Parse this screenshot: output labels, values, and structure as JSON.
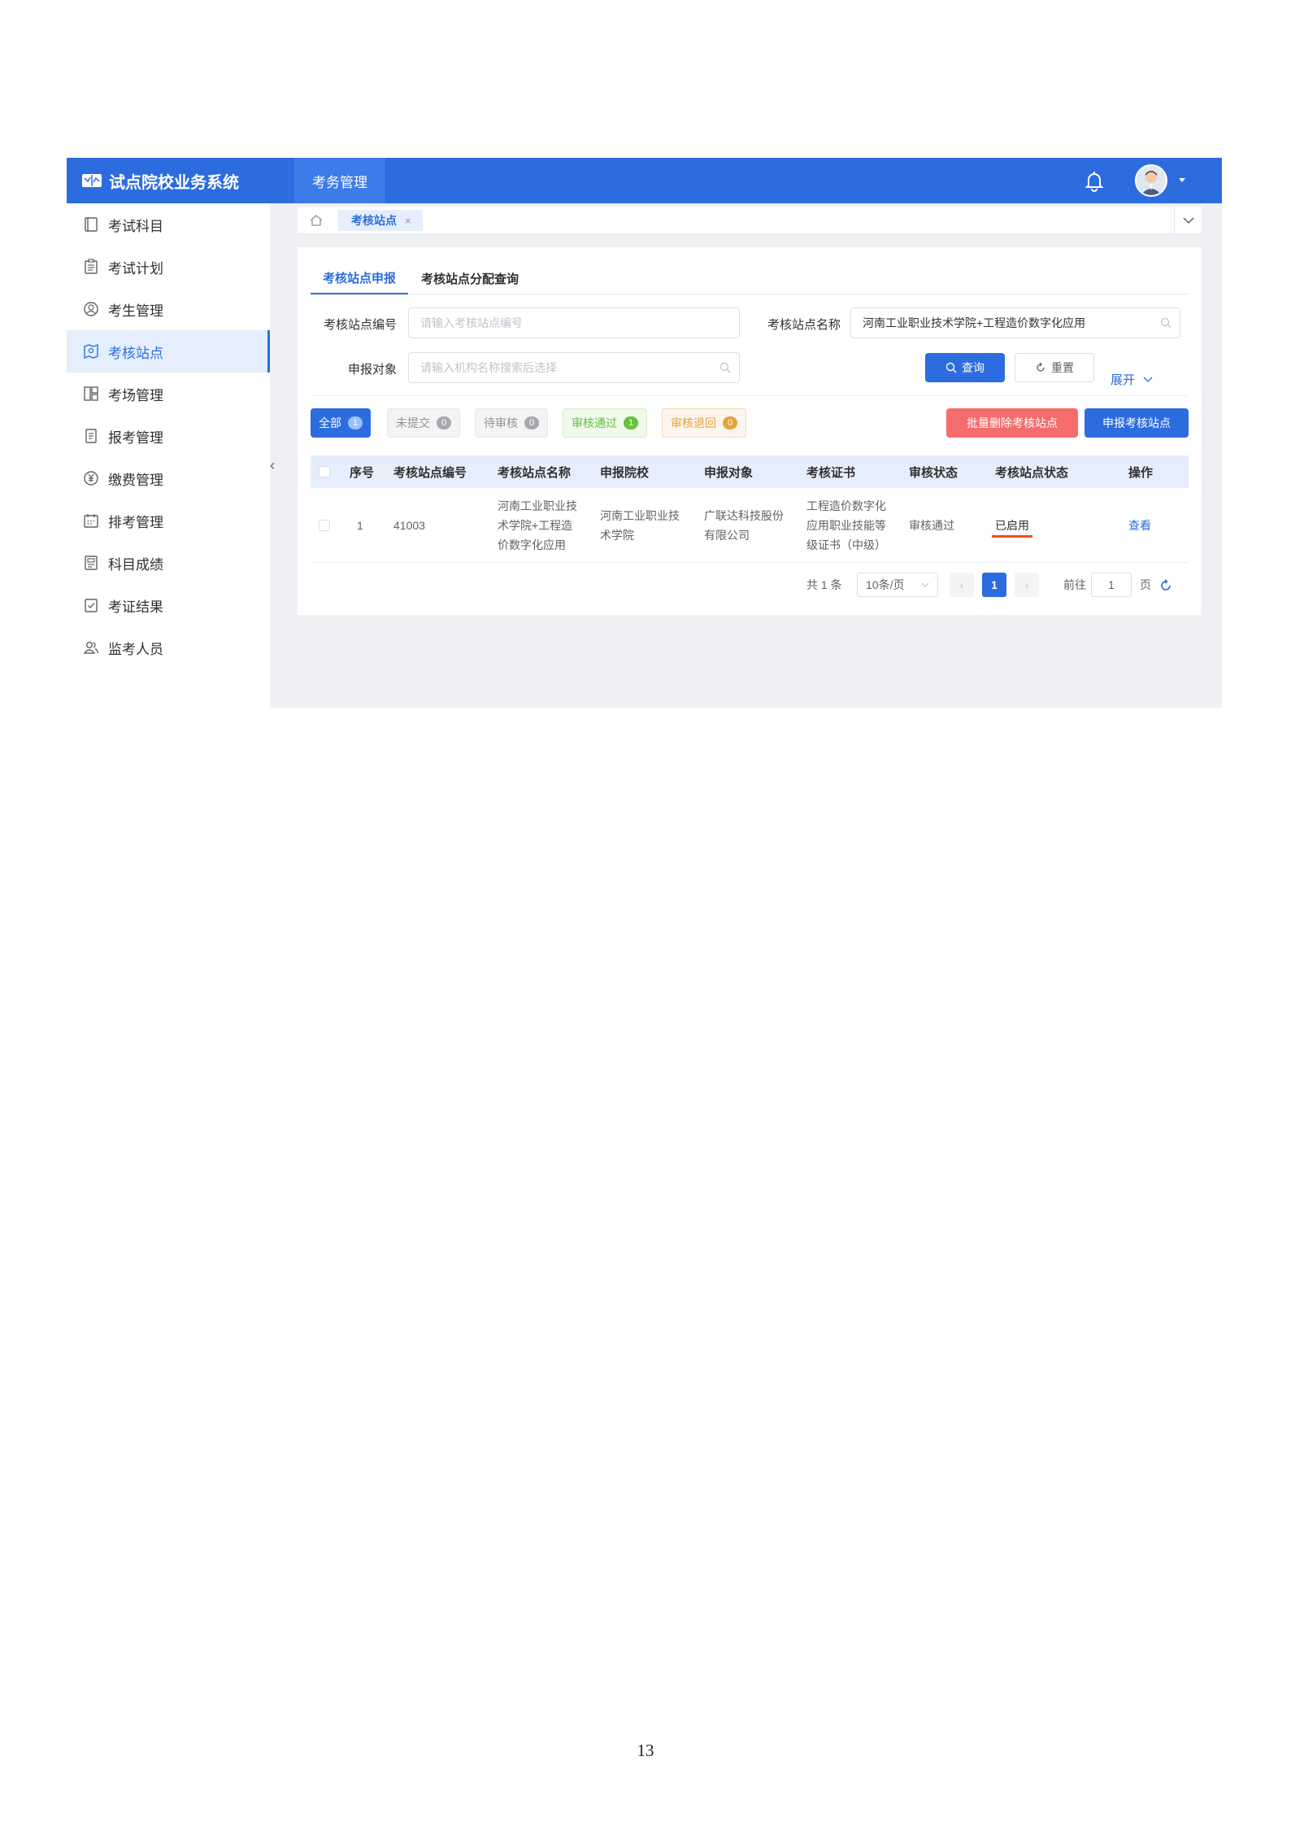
{
  "app": {
    "title": "试点院校业务系统",
    "top_nav": "考务管理"
  },
  "sidebar": {
    "items": [
      {
        "label": "考试科目",
        "icon": "book-icon",
        "active": false
      },
      {
        "label": "考试计划",
        "icon": "clipboard-icon",
        "active": false
      },
      {
        "label": "考生管理",
        "icon": "user-circle-icon",
        "active": false
      },
      {
        "label": "考核站点",
        "icon": "map-icon",
        "active": true
      },
      {
        "label": "考场管理",
        "icon": "layout-icon",
        "active": false
      },
      {
        "label": "报考管理",
        "icon": "document-icon",
        "active": false
      },
      {
        "label": "缴费管理",
        "icon": "yen-icon",
        "active": false
      },
      {
        "label": "排考管理",
        "icon": "calendar-icon",
        "active": false
      },
      {
        "label": "科目成绩",
        "icon": "report-icon",
        "active": false
      },
      {
        "label": "考证结果",
        "icon": "check-clipboard-icon",
        "active": false
      },
      {
        "label": "监考人员",
        "icon": "users-icon",
        "active": false
      }
    ]
  },
  "tagbar": {
    "tag_label": "考核站点",
    "close": "×"
  },
  "tabs": [
    {
      "label": "考核站点申报",
      "active": true
    },
    {
      "label": "考核站点分配查询",
      "active": false
    }
  ],
  "filters": {
    "code_label": "考核站点编号",
    "code_placeholder": "请输入考核站点编号",
    "name_label": "考核站点名称",
    "name_value": "河南工业职业技术学院+工程造价数字化应用",
    "target_label": "申报对象",
    "target_placeholder": "请输入机构名称搜索后选择",
    "search_button": "查询",
    "reset_button": "重置",
    "expand": "展开"
  },
  "status_tabs": [
    {
      "label": "全部",
      "count": "1"
    },
    {
      "label": "未提交",
      "count": "0"
    },
    {
      "label": "待审核",
      "count": "0"
    },
    {
      "label": "审核通过",
      "count": "1"
    },
    {
      "label": "审核退回",
      "count": "0"
    }
  ],
  "actions": {
    "batch_delete": "批量删除考核站点",
    "apply": "申报考核站点"
  },
  "table": {
    "headers": [
      "序号",
      "考核站点编号",
      "考核站点名称",
      "申报院校",
      "申报对象",
      "考核证书",
      "审核状态",
      "考核站点状态",
      "操作"
    ],
    "rows": [
      {
        "index": "1",
        "code": "41003",
        "name_lines": [
          "河南工业职业技",
          "术学院+工程造",
          "价数字化应用"
        ],
        "school_lines": [
          "河南工业职业技",
          "术学院"
        ],
        "target_lines": [
          "广联达科技股份",
          "有限公司"
        ],
        "cert_lines": [
          "工程造价数字化",
          "应用职业技能等",
          "级证书（中级）"
        ],
        "audit_status": "审核通过",
        "site_status": "已启用",
        "action": "查看"
      }
    ]
  },
  "pagination": {
    "total": "共 1 条",
    "page_size": "10条/页",
    "current": "1",
    "goto_label": "前往",
    "goto_value": "1",
    "page_unit": "页"
  },
  "page_number": "13",
  "colors": {
    "primary": "#2d6cdf",
    "danger": "#f56c6c",
    "success": "#67c23a",
    "warning": "#e6a23c"
  }
}
